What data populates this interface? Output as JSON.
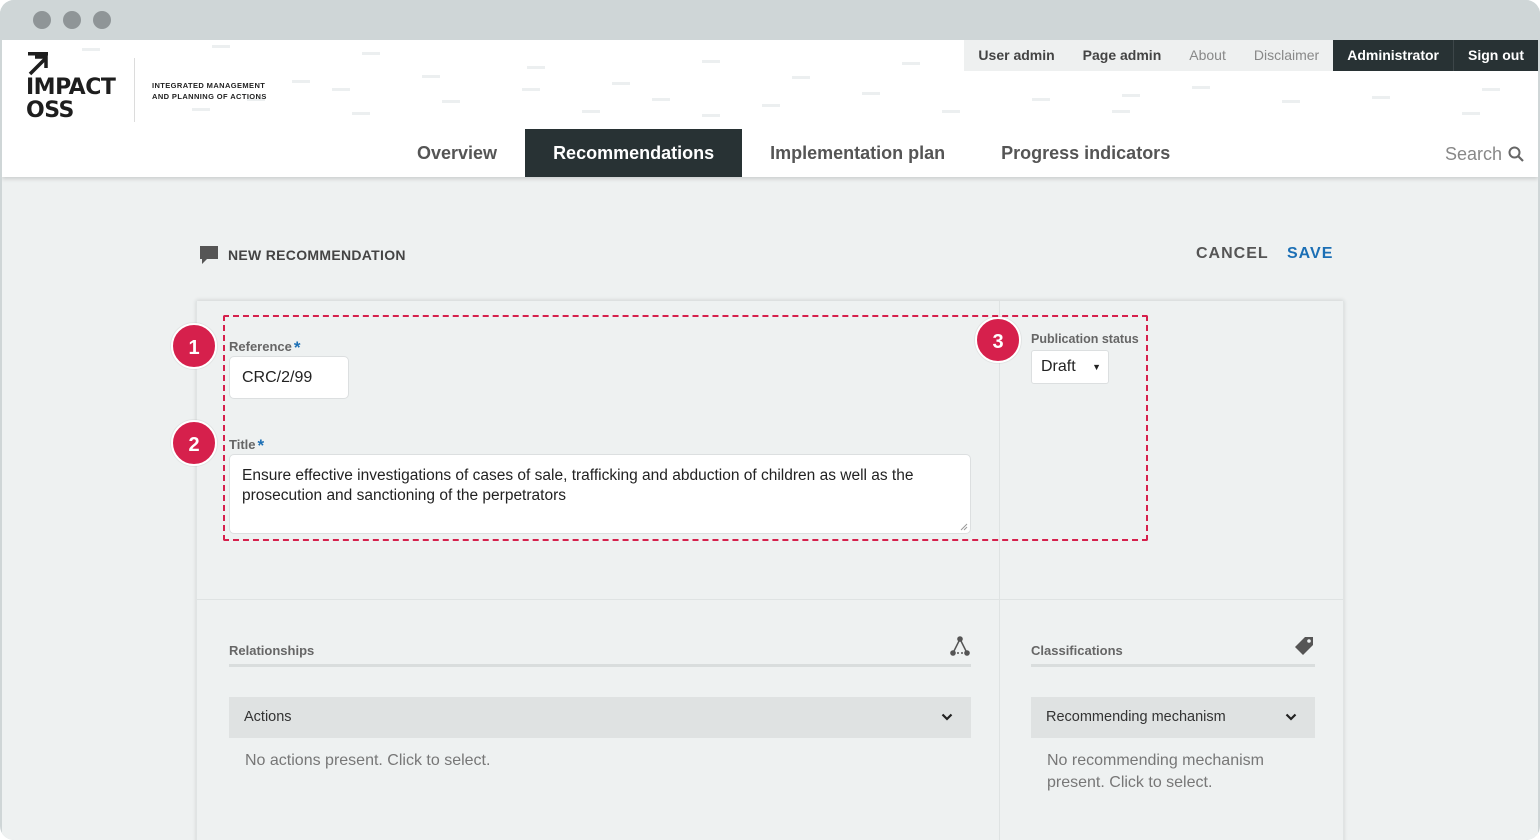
{
  "header": {
    "logo": {
      "title_line1": "IMPACT",
      "title_line2": "OSS",
      "tagline_line1": "INTEGRATED MANAGEMENT",
      "tagline_line2": "AND PLANNING OF ACTIONS"
    },
    "top_links": [
      "User admin",
      "Page admin",
      "About",
      "Disclaimer",
      "Administrator",
      "Sign out"
    ],
    "tabs": [
      "Overview",
      "Recommendations",
      "Implementation plan",
      "Progress indicators"
    ],
    "active_tab": "Recommendations",
    "search_label": "Search"
  },
  "page": {
    "heading": "NEW RECOMMENDATION",
    "cancel_label": "CANCEL",
    "save_label": "SAVE"
  },
  "form": {
    "reference": {
      "label": "Reference",
      "required_mark": "*",
      "value": "CRC/2/99"
    },
    "title": {
      "label": "Title",
      "required_mark": "*",
      "value": "Ensure effective investigations of cases of sale, trafficking and abduction of children as well as the prosecution and sanctioning of the perpetrators"
    },
    "publication_status": {
      "label": "Publication status",
      "value": "Draft"
    }
  },
  "callouts": [
    "1",
    "2",
    "3"
  ],
  "relationships": {
    "title": "Relationships",
    "actions_label": "Actions",
    "actions_empty": "No actions present. Click to select."
  },
  "classifications": {
    "title": "Classifications",
    "mechanism_label": "Recommending mechanism",
    "mechanism_empty_line1": "No recommending mechanism",
    "mechanism_empty_line2": "present. Click to select."
  },
  "colors": {
    "accent": "#d6204c",
    "link": "#1b6fb5",
    "dark_nav": "#283234",
    "page_bg": "#eef1f1"
  }
}
